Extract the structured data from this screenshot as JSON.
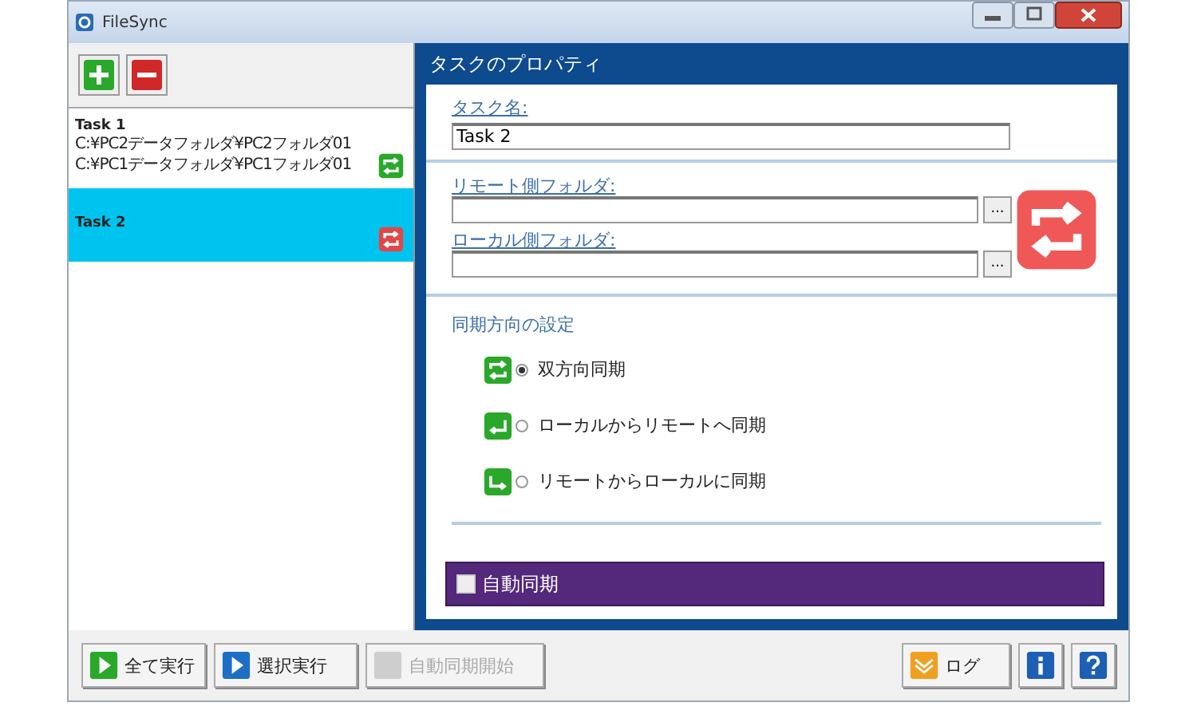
{
  "window": {
    "title": "FileSync"
  },
  "task_toolbar": [
    {
      "kind": "add"
    },
    {
      "kind": "remove"
    }
  ],
  "tasks": [
    {
      "name": "Task 1",
      "paths": [
        "C:¥PC2データフォルダ¥PC2フォルダ01",
        "C:¥PC1データフォルダ¥PC1フォルダ01"
      ],
      "color": "#2aa82a",
      "selected": false
    },
    {
      "name": "Task 2",
      "color": "#e04848",
      "selected": true
    }
  ],
  "properties": {
    "title": "タスクのプロパティ",
    "task_name": {
      "label": "タスク名:",
      "value": "Task 2"
    },
    "remote_folder": {
      "label": "リモート側フォルダ:",
      "browse": "..."
    },
    "local_folder": {
      "label": "ローカル側フォルダ:",
      "browse": "..."
    },
    "direction": {
      "title": "同期方向の設定",
      "options": [
        {
          "kind": "both",
          "label": "双方向同期",
          "selected": true
        },
        {
          "kind": "upload",
          "label": "ローカルからリモートへ同期",
          "selected": false
        },
        {
          "kind": "download",
          "label": "リモートからローカルに同期",
          "selected": false
        }
      ]
    },
    "auto_sync": {
      "label": "自動同期",
      "checked": false
    }
  },
  "bottom_buttons": [
    {
      "kind": "run-all",
      "label": "全て実行",
      "disabled": false
    },
    {
      "kind": "run-selected",
      "label": "選択実行",
      "disabled": false
    },
    {
      "kind": "auto-start",
      "label": "自動同期開始",
      "disabled": true
    },
    {
      "kind": "log",
      "label": "ログ",
      "disabled": false
    },
    {
      "kind": "info",
      "disabled": false
    },
    {
      "kind": "help",
      "disabled": false
    }
  ]
}
